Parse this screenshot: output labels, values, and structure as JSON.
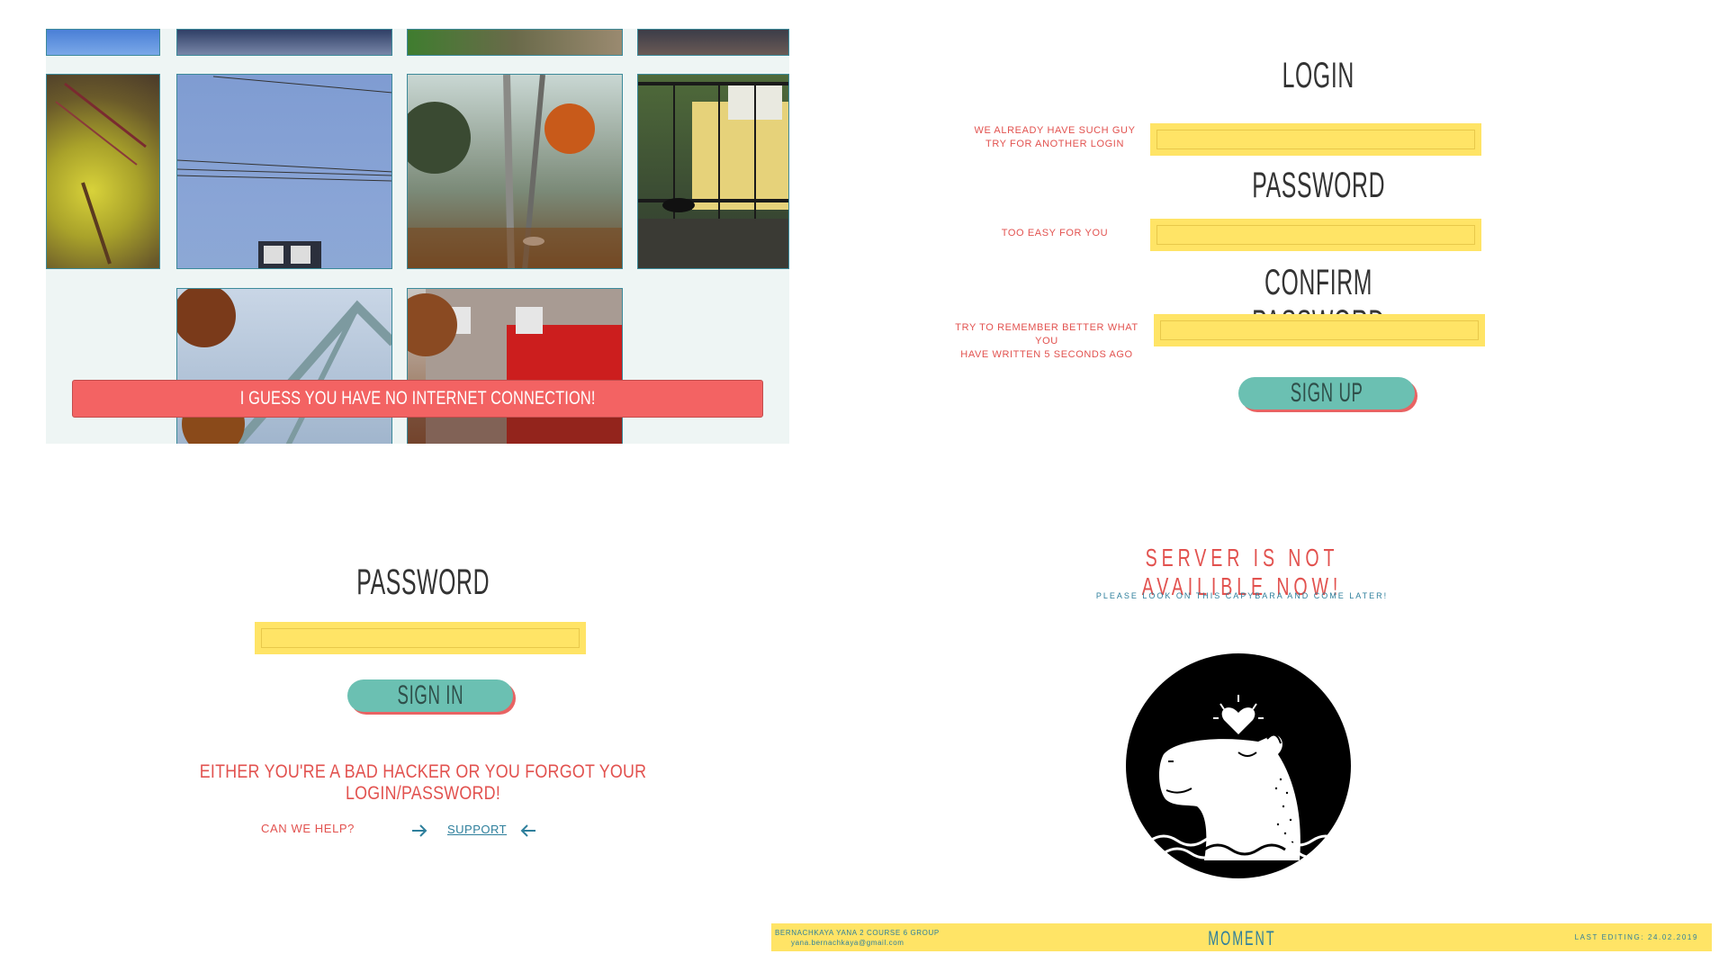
{
  "gallery": {
    "banner": "I GUESS YOU HAVE NO INTERNET CONNECTION!"
  },
  "signup": {
    "login_label": "LOGIN",
    "login_hint": [
      "WE ALREADY HAVE SUCH GUY",
      "TRY FOR ANOTHER LOGIN"
    ],
    "password_label": "PASSWORD",
    "password_hint": "TOO EASY FOR YOU",
    "confirm_label": "CONFIRM PASSWORD",
    "confirm_hint": [
      "TRY TO REMEMBER BETTER WHAT YOU",
      "HAVE WRITTEN 5 SECONDS AGO"
    ],
    "button": "SIGN UP"
  },
  "signin": {
    "password_label": "PASSWORD",
    "button": "SIGN IN",
    "error": "EITHER YOU'RE A BAD HACKER OR YOU FORGOT YOUR LOGIN/PASSWORD!",
    "help_label": "CAN WE HELP?",
    "support_link": "SUPPORT"
  },
  "server": {
    "title": "SERVER IS NOT AVAILIBLE NOW!",
    "subtitle": "PLEASE LOOK ON THIS CAPYBARA AND COME LATER!"
  },
  "footer": {
    "author_line1": "BERNACHKAYA YANA 2 COURSE 6 GROUP",
    "author_line2": "yana.bernachkaya@gmail.com",
    "brand": "MOMENT",
    "last_edit": "LAST EDITING: 24.02.2019"
  },
  "colors": {
    "accent_red": "#f36363",
    "field_yellow": "#ffe466",
    "button_teal": "#6bc0b2",
    "link_blue": "#2e7f9c"
  }
}
